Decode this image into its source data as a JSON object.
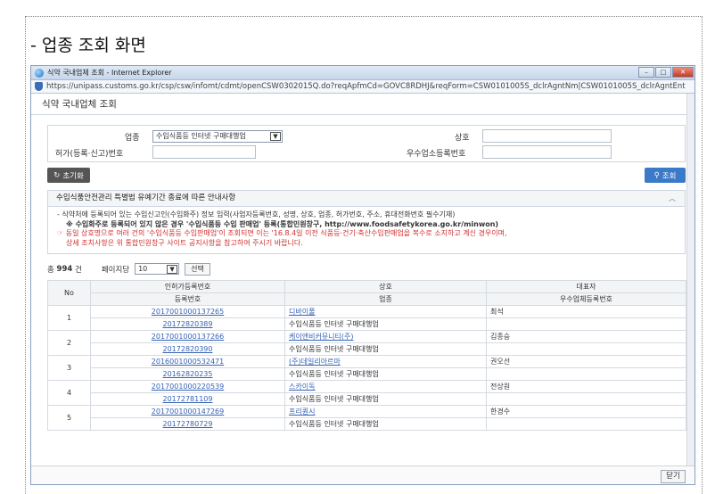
{
  "heading": "- 업종 조회 화면",
  "window": {
    "title": "식약 국내업체 조회 - Internet Explorer",
    "url": "https://unipass.customs.go.kr/csp/csw/infomt/cdmt/openCSW0302015Q.do?reqApfmCd=GOVC8RDHJ&reqForm=CSW0101005S_dclrAgntNm|CSW0101005S_dclrAgntEnt",
    "minimize": "–",
    "maximize": "□",
    "close": "✕"
  },
  "page_title": "식약 국내업체 조회",
  "search": {
    "industry_label": "업종",
    "industry_value": "수입식품등 인터넷 구매대행업",
    "firm_label": "상호",
    "firm_value": "",
    "license_label": "허가(등록·신고)번호",
    "license_value": "",
    "excellent_label": "우수업소등록번호",
    "excellent_value": ""
  },
  "buttons": {
    "reset": "초기화",
    "search": "조회",
    "select": "선택",
    "close": "닫기"
  },
  "notice": {
    "title": "수입식품안전관리 특별법 유예기간 종료에 따른 안내사항",
    "line1": "- 식약처에 등록되어 있는 수입신고인(수입화주) 정보 입력(사업자등록번호, 성명, 상호, 업종, 허가번호, 주소, 휴대전화번호 필수기재)",
    "line2": "※ 수입화주로 등록되어 있지 않은 경우 '수입식품등 수입 판매업' 등록(통합민원창구, http://www.foodsafetykorea.go.kr/minwon)",
    "line3": "☞ 동일 상호명으로 여러 건의 '수입식품등 수입판매업'이 조회되면 이는 '16.8.4일 이전 식품등·건기·축산수입판매업을 복수로 소지하고 계신 경우이며,",
    "line4": "상세 조치사항은 위 통합민원창구 사이트 공지사항을 참고하여 주시기 바랍니다."
  },
  "listing": {
    "total_prefix": "총",
    "total_count": "994",
    "total_suffix": "건",
    "per_page_label": "페이지당",
    "per_page_value": "10"
  },
  "table": {
    "headers": {
      "no": "No",
      "license": "인허가등록번호",
      "registration": "등록번호",
      "firm": "상호",
      "industry": "업종",
      "rep": "대표자",
      "excellent": "우수업체등록번호"
    },
    "rows": [
      {
        "no": "1",
        "license": "2017001000137265",
        "registration": "20172820389",
        "firm": "디바이풀",
        "industry": "수입식품등 인터넷 구매대행업",
        "rep": "최석",
        "excellent": ""
      },
      {
        "no": "2",
        "license": "2017001000137266",
        "registration": "20172820390",
        "firm": "케이앤비커뮤니티(주)",
        "industry": "수입식품등 인터넷 구매대행업",
        "rep": "김종승",
        "excellent": ""
      },
      {
        "no": "3",
        "license": "2016001000532471",
        "registration": "20162820235",
        "firm": "(주)데일리아르마",
        "industry": "수입식품등 인터넷 구매대행업",
        "rep": "권오선",
        "excellent": ""
      },
      {
        "no": "4",
        "license": "2017001000220539",
        "registration": "20172781109",
        "firm": "스카이독",
        "industry": "수입식품등 인터넷 구매대행업",
        "rep": "전상원",
        "excellent": ""
      },
      {
        "no": "5",
        "license": "2017001000147269",
        "registration": "20172780729",
        "firm": "프리퀀시",
        "industry": "수입식품등 인터넷 구매대행업",
        "rep": "한경수",
        "excellent": ""
      }
    ]
  }
}
